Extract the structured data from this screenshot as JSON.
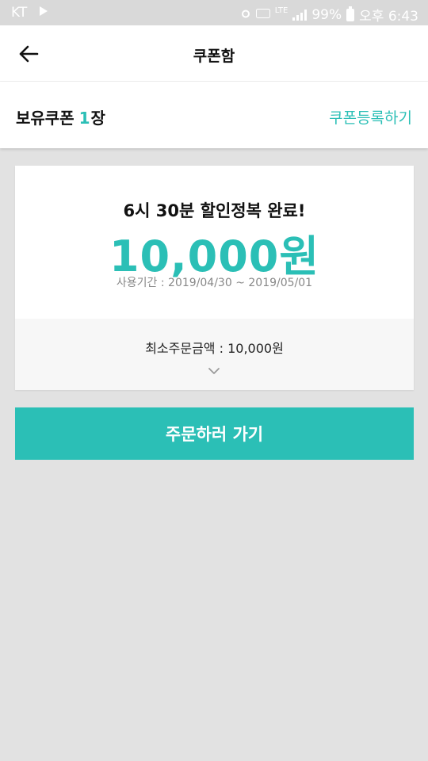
{
  "status_bar": {
    "carrier": "KT",
    "network": "LTE",
    "battery": "99%",
    "time": "오후 6:43"
  },
  "app_bar": {
    "title": "쿠폰함"
  },
  "holdings": {
    "label": "보유쿠폰",
    "count": "1",
    "unit": "장",
    "register_link": "쿠폰등록하기"
  },
  "coupon": {
    "name": "6시 30분 할인정복 완료!",
    "amount": "10,000원",
    "period": "사용기간 : 2019/04/30 ~ 2019/05/01",
    "min_order": "최소주문금액 : 10,000원"
  },
  "order_button": {
    "label": "주문하러 가기"
  },
  "colors": {
    "accent": "#2bbfb6",
    "background": "#e2e2e2",
    "status_bar": "#d9d9d9"
  }
}
